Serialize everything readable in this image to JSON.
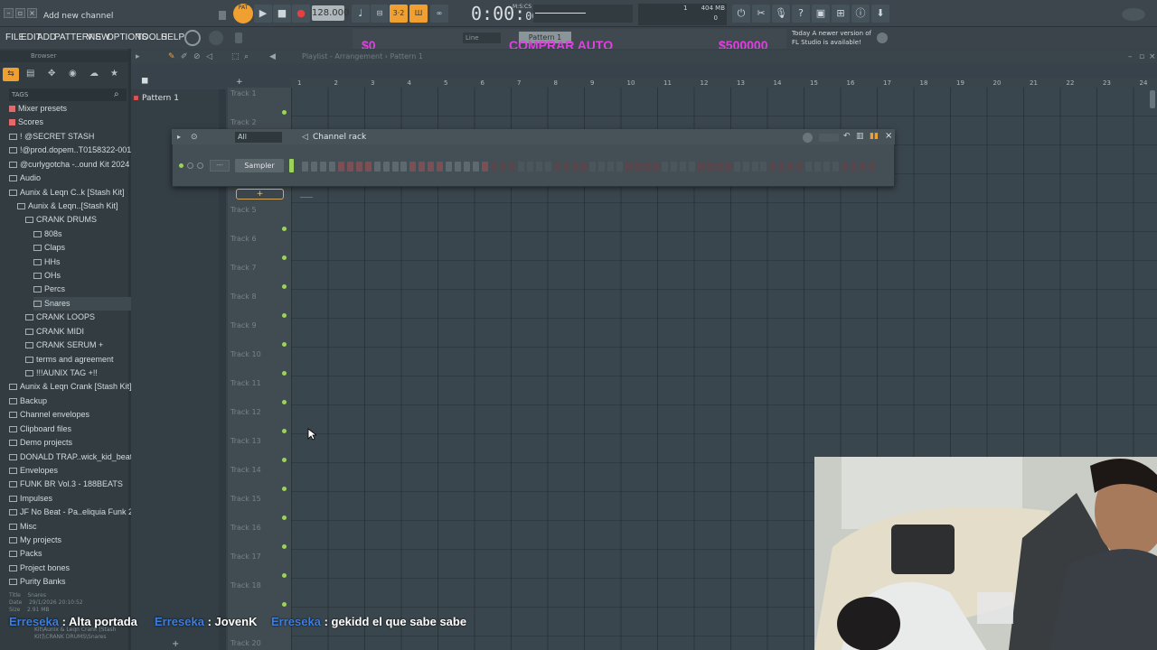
{
  "topbar": {
    "hint": "Add new channel",
    "tempo": "128.000",
    "time_main": "0:00",
    "time_sub": "00",
    "time_unit": "M:S:CS",
    "memory_label": "404 MB",
    "memory_line2": "0",
    "cpu_value": "1",
    "pat_label": "PAT"
  },
  "menu": {
    "items": [
      "FILE",
      "EDIT",
      "ADD",
      "PATTERNS",
      "VIEW",
      "OPTIONS",
      "TOOLS",
      "HELP"
    ]
  },
  "overlay": {
    "stat_left": "$0",
    "stat_center": "COMPRAR AUTO",
    "stat_right": "$500000",
    "snap": "Line",
    "pattern_selector": "Pattern 1"
  },
  "news": {
    "line1": "Today  A newer version of",
    "line2": "FL Studio is available!"
  },
  "browser": {
    "title": "Browser",
    "tags_label": "TAGS",
    "items": [
      {
        "label": "Mixer presets",
        "indent": 0
      },
      {
        "label": "Scores",
        "indent": 0
      },
      {
        "label": "! @SECRET STASH",
        "indent": 0
      },
      {
        "label": "!@prod.dopem..T0158322-001",
        "indent": 0
      },
      {
        "label": "@curlygotcha -..ound Kit 2024",
        "indent": 0
      },
      {
        "label": "Audio",
        "indent": 0
      },
      {
        "label": "Aunix & Leqn C..k [Stash Kit]",
        "indent": 0
      },
      {
        "label": "Aunix & Leqn..[Stash Kit]",
        "indent": 1
      },
      {
        "label": "CRANK DRUMS",
        "indent": 2
      },
      {
        "label": "808s",
        "indent": 3
      },
      {
        "label": "Claps",
        "indent": 3
      },
      {
        "label": "HHs",
        "indent": 3
      },
      {
        "label": "OHs",
        "indent": 3
      },
      {
        "label": "Percs",
        "indent": 3
      },
      {
        "label": "Snares",
        "indent": 3
      },
      {
        "label": "CRANK LOOPS",
        "indent": 2
      },
      {
        "label": "CRANK MIDI",
        "indent": 2
      },
      {
        "label": "CRANK SERUM +",
        "indent": 2
      },
      {
        "label": "terms and agreement",
        "indent": 2
      },
      {
        "label": "!!!AUNIX TAG +!!",
        "indent": 2
      },
      {
        "label": "Aunix & Leqn Crank [Stash Kit]",
        "indent": 0
      },
      {
        "label": "Backup",
        "indent": 0
      },
      {
        "label": "Channel envelopes",
        "indent": 0
      },
      {
        "label": "Clipboard files",
        "indent": 0
      },
      {
        "label": "Demo projects",
        "indent": 0
      },
      {
        "label": "DONALD TRAP..wick_kid_beats",
        "indent": 0
      },
      {
        "label": "Envelopes",
        "indent": 0
      },
      {
        "label": "FUNK BR Vol.3 - 188BEATS",
        "indent": 0
      },
      {
        "label": "Impulses",
        "indent": 0
      },
      {
        "label": "JF No Beat - Pa..eliquia Funk 2",
        "indent": 0
      },
      {
        "label": "Misc",
        "indent": 0
      },
      {
        "label": "My projects",
        "indent": 0
      },
      {
        "label": "Packs",
        "indent": 0
      },
      {
        "label": "Project bones",
        "indent": 0
      },
      {
        "label": "Purity Banks",
        "indent": 0
      }
    ],
    "selected_index": 14,
    "info": {
      "title_label": "Title",
      "title_value": "Snares",
      "date_label": "Date",
      "date_value": "29/1/2026 20:10:52",
      "size_label": "Size",
      "size_value": "2.91 MB",
      "path_value": "Kit\\Aunix & Leqn Crank [Stash Kit]\\CRANK DRUMS\\Snares"
    }
  },
  "playlist": {
    "title": "Playlist - Arrangement › Pattern 1",
    "patterns": [
      "Pattern 1"
    ],
    "tracks": [
      "Track 1",
      "Track 2",
      "Track 5",
      "Track 6",
      "Track 7",
      "Track 8",
      "Track 9",
      "Track 10",
      "Track 11",
      "Track 12",
      "Track 13",
      "Track 14",
      "Track 15",
      "Track 16",
      "Track 17",
      "Track 18",
      "Track 20"
    ],
    "bars": [
      "1",
      "2",
      "3",
      "4",
      "5",
      "6",
      "7",
      "8",
      "9",
      "10",
      "11",
      "12",
      "13",
      "14",
      "15",
      "16",
      "17",
      "18",
      "19",
      "20",
      "21",
      "22",
      "23",
      "24"
    ]
  },
  "channel_rack": {
    "title": "Channel rack",
    "filter": "All",
    "channel_name": "Sampler",
    "add_label": "+",
    "step_count": 64,
    "highlighted_steps": 21
  },
  "chat": [
    {
      "user": "Erreseka",
      "message": "Alta portada"
    },
    {
      "user": "Erreseka",
      "message": "JovenK"
    },
    {
      "user": "Erreseka",
      "message": "gekidd el que sabe sabe"
    }
  ],
  "colors": {
    "accent_orange": "#f0a030",
    "stat_magenta": "#e040e0",
    "track_dot_green": "#9bd35a",
    "chat_user_blue": "#3d7fe0"
  }
}
